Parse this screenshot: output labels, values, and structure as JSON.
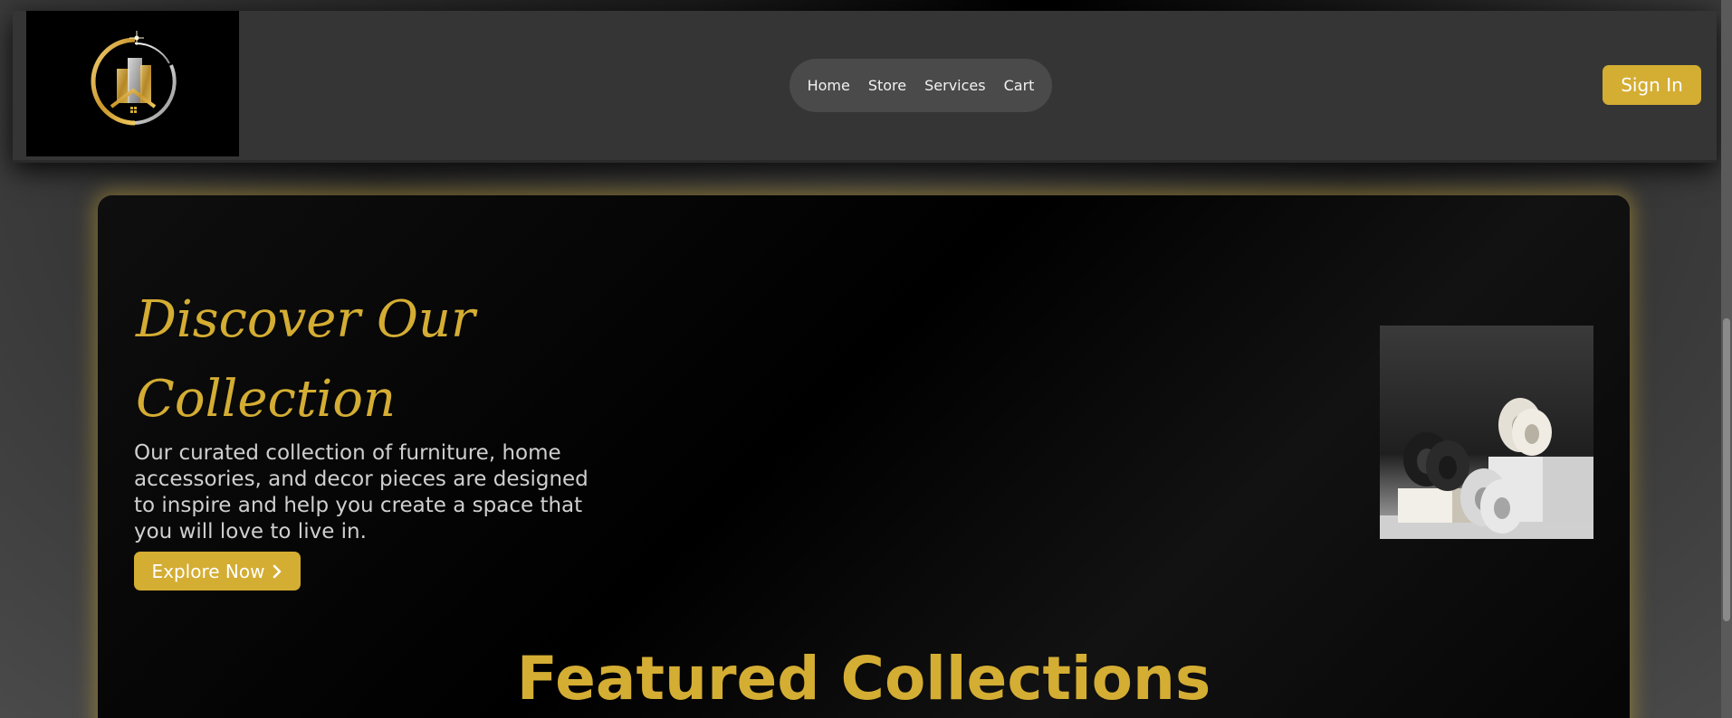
{
  "navbar": {
    "logo_icon": "building-logo-icon",
    "links": [
      {
        "label": "Home"
      },
      {
        "label": "Store"
      },
      {
        "label": "Services"
      },
      {
        "label": "Cart"
      }
    ],
    "signin_label": "Sign In"
  },
  "hero": {
    "title": "Discover Our Collection",
    "description": "Our curated collection of furniture, home accessories, and decor pieces are designed to inspire and help you create a space that you will love to live in.",
    "cta_label": "Explore Now",
    "cta_icon": "chevron-right-icon",
    "image": "vases-on-pedestals-image"
  },
  "featured": {
    "title": "Featured Collections"
  },
  "colors": {
    "accent": "#d4ad33",
    "navbar_bg": "#353535",
    "nav_pill_bg": "#4a4a4a",
    "hero_bg": "#000000"
  }
}
